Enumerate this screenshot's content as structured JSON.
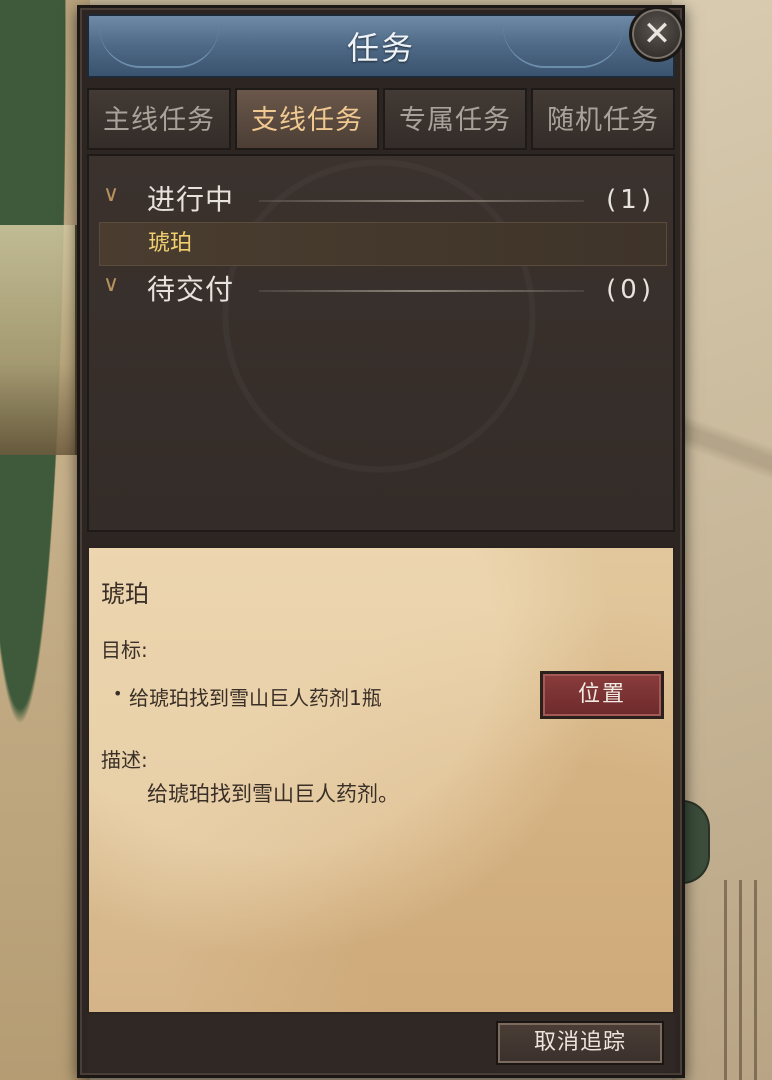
{
  "window": {
    "title": "任务",
    "close_symbol": "✕"
  },
  "tabs": [
    {
      "label": "主线任务",
      "active": false
    },
    {
      "label": "支线任务",
      "active": true
    },
    {
      "label": "专属任务",
      "active": false
    },
    {
      "label": "随机任务",
      "active": false
    }
  ],
  "groups": [
    {
      "label": "进行中",
      "count": "(1)",
      "expanded": true
    },
    {
      "label": "待交付",
      "count": "(0)",
      "expanded": true
    }
  ],
  "quests": [
    {
      "name": "琥珀",
      "selected": true
    }
  ],
  "detail": {
    "title": "琥珀",
    "goal_label": "目标:",
    "goal_bullet": "•",
    "goal_item": "给琥珀找到雪山巨人药剂1瓶",
    "locate_label": "位置",
    "desc_label": "描述:",
    "desc_text": "给琥珀找到雪山巨人药剂。"
  },
  "footer": {
    "untrack_label": "取消追踪"
  },
  "icons": {
    "group_chevron": "chevron-down-icon",
    "close": "close-icon"
  },
  "colors": {
    "titlebar": "#4e6986",
    "active_tab_text": "#f0c990",
    "quest_highlight": "#f2d070",
    "parchment": "#dcbf93",
    "locate_button": "#7a3233"
  }
}
